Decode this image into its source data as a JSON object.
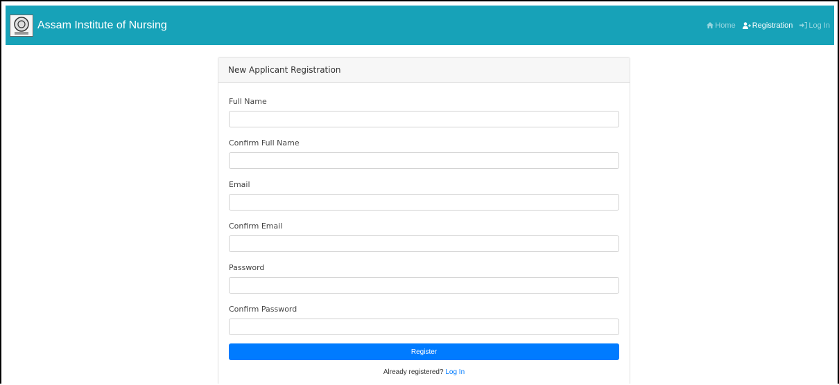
{
  "navbar": {
    "brand": "Assam Institute of Nursing",
    "links": [
      {
        "label": "Home",
        "icon": "home-icon"
      },
      {
        "label": "Registration",
        "icon": "user-plus-icon"
      },
      {
        "label": "Log In",
        "icon": "sign-in-icon"
      }
    ],
    "color": "#17a2b8"
  },
  "card": {
    "title": "New Applicant Registration",
    "fields": [
      {
        "label": "Full Name",
        "value": ""
      },
      {
        "label": "Confirm Full Name",
        "value": ""
      },
      {
        "label": "Email",
        "value": ""
      },
      {
        "label": "Confirm Email",
        "value": ""
      },
      {
        "label": "Password",
        "value": ""
      },
      {
        "label": "Confirm Password",
        "value": ""
      }
    ],
    "submit_label": "Register",
    "footer_prefix": "Already registered?",
    "footer_link": "Log In",
    "button_color": "#007bff"
  }
}
